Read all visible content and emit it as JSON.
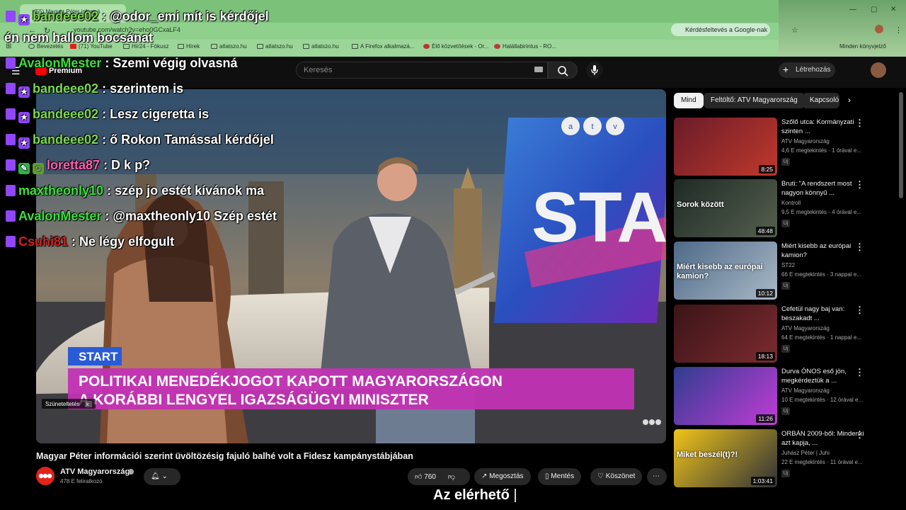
{
  "browser": {
    "tab_title": "(55) Magyar Péter informá",
    "url": "youtube.com/watch?v=eho0GCxaLF4",
    "google_button": "Kérdésfeltevés a Google-nak",
    "bookmarks": [
      "Bevezetés",
      "(71) YouTube",
      "Hír24 - Fókusz",
      "Hírek",
      "atlatszo.hu",
      "atlatszo.hu",
      "atlatszo.hu",
      "A Firefox alkalmazá...",
      "Élő közvetítések - Or...",
      "Halállabirintus - RO..."
    ],
    "other_bookmarks": "Minden könyvjelző"
  },
  "youtube": {
    "brand": "Premium",
    "search_placeholder": "Keresés",
    "create_label": "Létrehozás"
  },
  "chat": [
    {
      "user": "bandeee02",
      "user_color": "#7bd84f",
      "message": ": @odor_emi mít is kérdőjel",
      "badge": "star"
    },
    {
      "user": "",
      "user_color": "#ffffff",
      "message": "én nem hallom bocsánat",
      "badge": ""
    },
    {
      "user": "AvalonMester",
      "user_color": "#39e03a",
      "message": ": Szemi végig olvasná",
      "badge": ""
    },
    {
      "user": "bandeee02",
      "user_color": "#7bd84f",
      "message": ": szerintem is",
      "badge": "star"
    },
    {
      "user": "bandeee02",
      "user_color": "#7bd84f",
      "message": ": Lesz cigeretta is",
      "badge": "star"
    },
    {
      "user": "bandeee02",
      "user_color": "#7bd84f",
      "message": ": ő Rokon Tamással kérdőjel",
      "badge": "star"
    },
    {
      "user": "loretta87",
      "user_color": "#ff5fb0",
      "message": ": D k p?",
      "badge": "pencil"
    },
    {
      "user": "maxtheonly10",
      "user_color": "#39e03a",
      "message": ": szép jo estét kívánok ma",
      "badge": ""
    },
    {
      "user": "AvalonMester",
      "user_color": "#39e03a",
      "message": ": @maxtheonly10 Szép estét",
      "badge": ""
    },
    {
      "user": "Csuhi81",
      "user_color": "#d42020",
      "message": ": Ne légy elfogult",
      "badge": ""
    }
  ],
  "video": {
    "channel_logo": "atv",
    "screen_text": "STA",
    "lower_third_tag": "START",
    "headline_line1": "POLITIKAI MENEDÉKJOGOT KAPOTT MAGYARORSZÁGON",
    "headline_line2": "A KORÁBBI LENGYEL IGAZSÁGÜGYI MINISZTER",
    "pause_label": "Szüneteltetés",
    "pause_key": "k",
    "title": "Magyar Péter információi szerint üvöltözésig fajuló balhé volt a Fidesz kampánystábjában",
    "channel": "ATV Magyarország",
    "subscribers": "478 E feliratkozó",
    "likes": "760",
    "share": "Megosztás",
    "save": "Mentés",
    "thanks": "Köszönet"
  },
  "chips": [
    "Mind",
    "Feltöltő: ATV Magyarország",
    "Kapcsoló"
  ],
  "recommendations": [
    {
      "title": "Szőlő utca: Kormányzati szinten ...",
      "channel": "ATV Magyarország",
      "meta": "4,6 E megtekintés · 1 órával e...",
      "duration": "8:25",
      "thumb_text": "",
      "colors": [
        "#6a1b2a",
        "#c0392b"
      ]
    },
    {
      "title": "Bruti: \"A rendszert most nagyon könnyű ...",
      "channel": "Kontroll",
      "meta": "9,5 E megtekintés · 4 órával e...",
      "duration": "48:48",
      "thumb_text": "Sorok között",
      "colors": [
        "#1f2a26",
        "#55604f"
      ]
    },
    {
      "title": "Miért kisebb az európai kamion?",
      "channel": "ST22",
      "meta": "66 E megtekintés · 3 nappal e...",
      "duration": "10:12",
      "thumb_text": "Miért kisebb az európai kamion?",
      "colors": [
        "#4e6a88",
        "#a9b9c6"
      ]
    },
    {
      "title": "Cefetül nagy baj van: beszakadt ...",
      "channel": "ATV Magyarország",
      "meta": "64 E megtekintés · 1 nappal e...",
      "duration": "18:13",
      "thumb_text": "",
      "colors": [
        "#3b1418",
        "#7c2b2f"
      ]
    },
    {
      "title": "Durva ÓNOS eső jön, megkérdeztük a ...",
      "channel": "ATV Magyarország",
      "meta": "10 E megtekintés · 12 órával e...",
      "duration": "11:26",
      "thumb_text": "",
      "colors": [
        "#2f3d8f",
        "#c23bd6"
      ]
    },
    {
      "title": "ORBÁN 2009-ből: Mindenki azt kapja, ...",
      "channel": "Juhász Péter | Juhi",
      "meta": "22 E megtekintés · 11 órával e...",
      "duration": "1:03:41",
      "thumb_text": "Miket beszél(t)?!",
      "colors": [
        "#f0c419",
        "#2e3138"
      ]
    }
  ],
  "new_label": "Új",
  "caption": "Az elérhető"
}
